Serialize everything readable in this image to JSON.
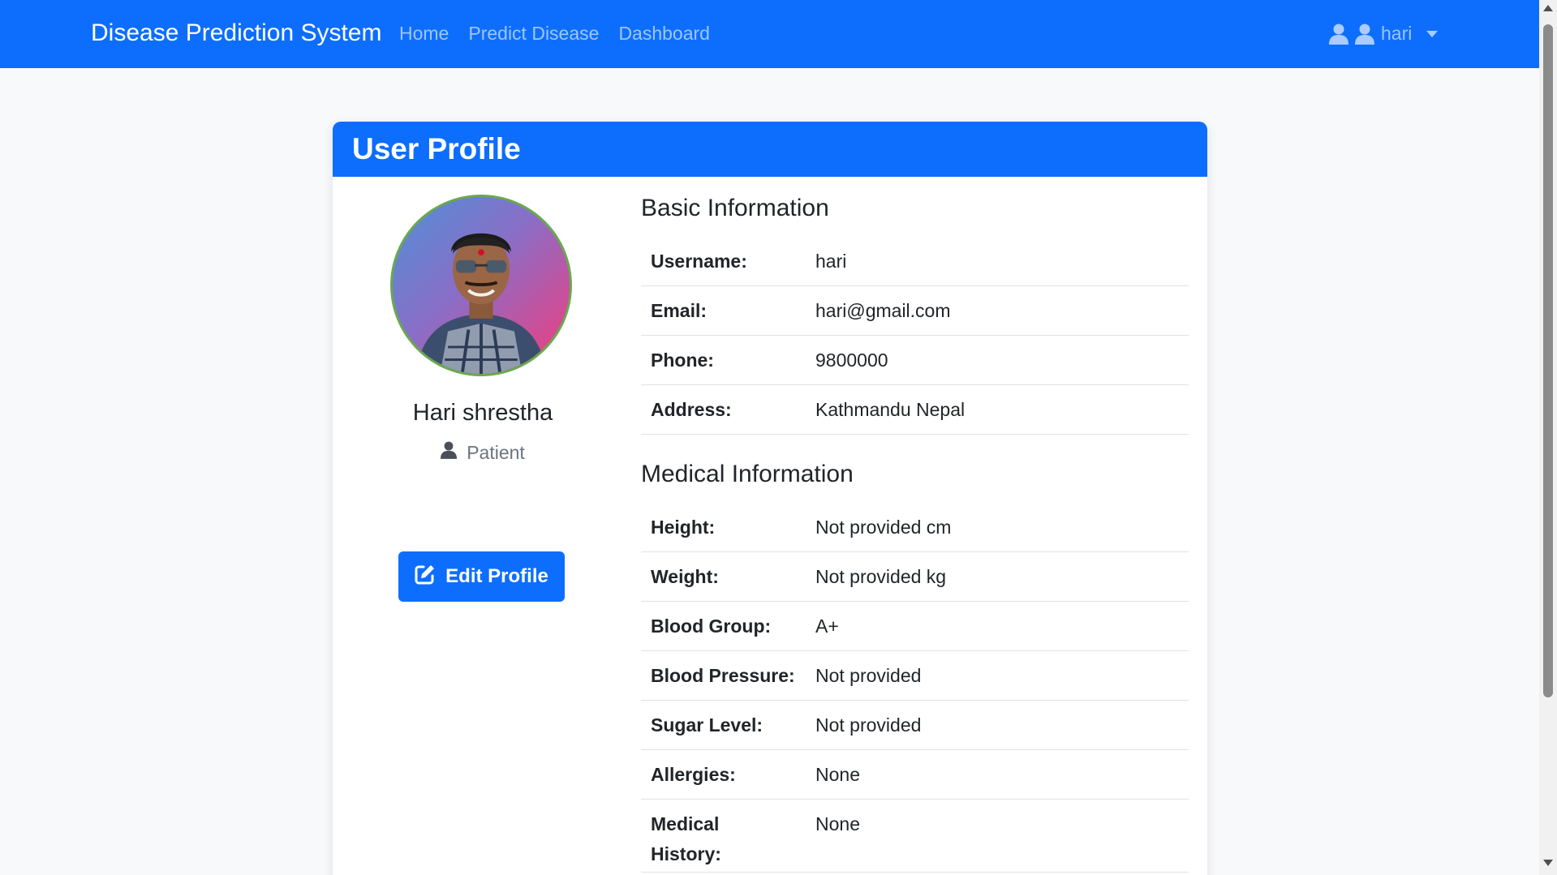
{
  "navbar": {
    "brand": "Disease Prediction System",
    "links": [
      "Home",
      "Predict Disease",
      "Dashboard"
    ],
    "user": "hari"
  },
  "card": {
    "title": "User Profile"
  },
  "profile": {
    "name": "Hari shrestha",
    "role": "Patient",
    "edit_label": "Edit Profile"
  },
  "basic": {
    "title": "Basic Information",
    "rows": [
      {
        "label": "Username:",
        "value": "hari"
      },
      {
        "label": "Email:",
        "value": "hari@gmail.com"
      },
      {
        "label": "Phone:",
        "value": "9800000"
      },
      {
        "label": "Address:",
        "value": "Kathmandu Nepal"
      }
    ]
  },
  "medical": {
    "title": "Medical Information",
    "rows": [
      {
        "label": "Height:",
        "value": "Not provided cm"
      },
      {
        "label": "Weight:",
        "value": "Not provided kg"
      },
      {
        "label": "Blood Group:",
        "value": "A+"
      },
      {
        "label": "Blood Pressure:",
        "value": "Not provided"
      },
      {
        "label": "Sugar Level:",
        "value": "Not provided"
      },
      {
        "label": "Allergies:",
        "value": "None"
      },
      {
        "label": "Medical History:",
        "value": "None"
      }
    ]
  },
  "colors": {
    "primary": "#0d6efd",
    "background": "#f8f9fa",
    "avatar_border": "#6aa84f"
  },
  "icons": {
    "user": "user-icon",
    "edit": "pen-to-square-icon",
    "caret": "caret-down-icon"
  }
}
